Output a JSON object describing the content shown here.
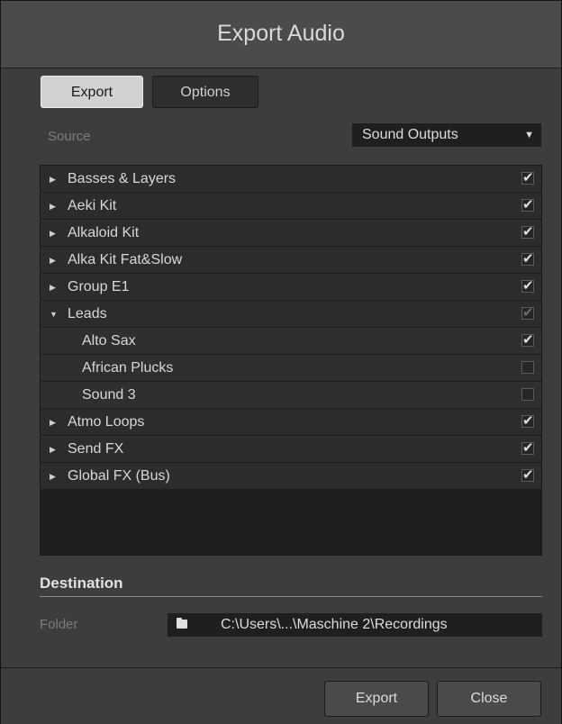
{
  "window": {
    "title": "Export Audio"
  },
  "tabs": {
    "export_label": "Export",
    "options_label": "Options"
  },
  "source": {
    "label": "Source",
    "value": "Sound Outputs"
  },
  "list": {
    "items": [
      {
        "label": "Basses & Layers",
        "checked": "on"
      },
      {
        "label": "Aeki Kit",
        "checked": "on"
      },
      {
        "label": "Alkaloid Kit",
        "checked": "on"
      },
      {
        "label": "Alka Kit Fat&Slow",
        "checked": "on"
      },
      {
        "label": "Group E1",
        "checked": "on"
      },
      {
        "label": "Leads",
        "checked": "partial",
        "expanded": true
      },
      {
        "label": "Alto Sax",
        "checked": "on",
        "child": true
      },
      {
        "label": "African Plucks",
        "checked": "off",
        "child": true
      },
      {
        "label": "Sound 3",
        "checked": "off",
        "child": true
      },
      {
        "label": "Atmo Loops",
        "checked": "on"
      },
      {
        "label": "Send FX",
        "checked": "on"
      },
      {
        "label": "Global FX (Bus)",
        "checked": "on"
      }
    ]
  },
  "destination": {
    "title": "Destination",
    "folder_label": "Folder",
    "folder_path": "C:\\Users\\...\\Maschine 2\\Recordings"
  },
  "footer": {
    "export_label": "Export",
    "close_label": "Close"
  }
}
